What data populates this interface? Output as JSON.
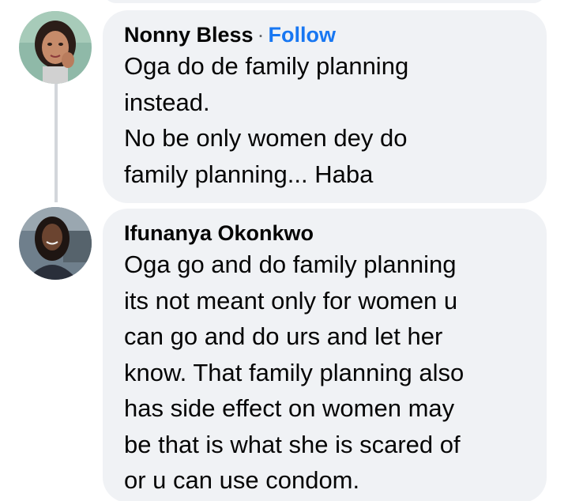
{
  "comments": [
    {
      "author": "Nonny Bless",
      "separator": "·",
      "follow_label": "Follow",
      "text_lines": [
        "Oga do de family planning",
        "instead.",
        "No be only women dey do",
        "family planning... Haba"
      ]
    },
    {
      "author": "Ifunanya Okonkwo",
      "text_lines": [
        "Oga go and do family planning",
        "its not meant  only for women u",
        "can go and do urs and let her",
        "know. That family planning also",
        "has side effect on women may",
        "be that is what she is scared of",
        "or u can use condom."
      ]
    }
  ],
  "colors": {
    "bubble_background": "#f0f2f5",
    "follow_link": "#1877f2",
    "text": "#050505",
    "thread_line": "#d3d6db"
  },
  "icons": {
    "avatar_1": "avatar-photo-woman",
    "avatar_2": "avatar-photo-woman"
  }
}
